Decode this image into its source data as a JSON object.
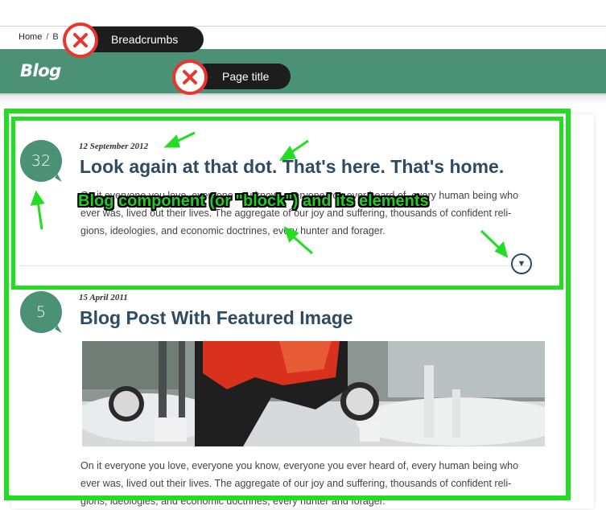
{
  "breadcrumb": {
    "home": "Home",
    "sep": "/",
    "current": "B"
  },
  "page": {
    "title": "Blog"
  },
  "annotations": {
    "breadcrumbs_tag": "Breadcrumbs",
    "page_title_tag": "Page title",
    "block_label": "Blog component (or \"block\") and its elements"
  },
  "posts": [
    {
      "comments": "32",
      "date": "12 September 2012",
      "title": "Look again at that dot. That's here. That's home.",
      "body_lines": [
        "On it everyone you love, everyone you know, everyone you ever heard of, every human being who",
        "ever was, lived out their lives. The aggregate of our joy and suffering, thousands of confident reli-",
        "gions, ideologies, and economic doctrines, every hunter and forager."
      ]
    },
    {
      "comments": "5",
      "date": "15 April 2011",
      "title": "Blog Post With Featured Image",
      "body_lines": [
        "On it everyone you love, everyone you know, everyone you ever heard of, every human being who",
        "ever was, lived out their lives. The aggregate of our joy and suffering, thousands of confident reli-",
        "gions, ideologies, and economic doctrines, every hunter and forager."
      ]
    }
  ],
  "colors": {
    "brand": "#4a9176",
    "title": "#2f4b63",
    "highlight": "#22dd22",
    "reject": "#e8362e"
  },
  "icons": {
    "read_more": "chevron-down-circle-icon",
    "reject": "close-icon"
  }
}
